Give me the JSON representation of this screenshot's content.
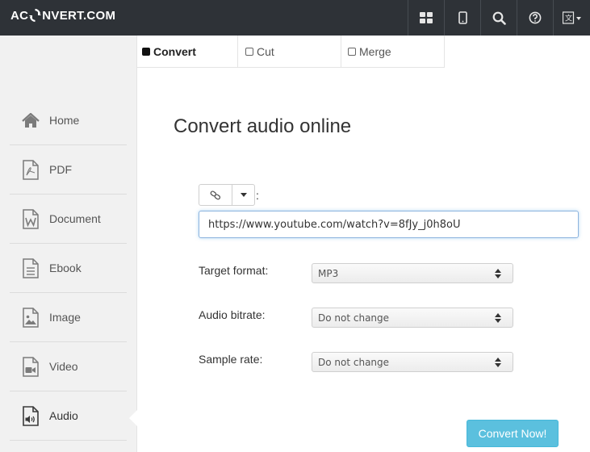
{
  "brand": {
    "left": "AC",
    "right": "NVERT.COM"
  },
  "header": {
    "icons": [
      "apps-grid-icon",
      "mobile-icon",
      "search-icon",
      "help-icon",
      "language-icon"
    ]
  },
  "sidebar": {
    "items": [
      {
        "label": "Home",
        "icon": "home-icon"
      },
      {
        "label": "PDF",
        "icon": "pdf-icon"
      },
      {
        "label": "Document",
        "icon": "document-icon"
      },
      {
        "label": "Ebook",
        "icon": "ebook-icon"
      },
      {
        "label": "Image",
        "icon": "image-icon"
      },
      {
        "label": "Video",
        "icon": "video-icon"
      },
      {
        "label": "Audio",
        "icon": "audio-icon",
        "active": true
      }
    ]
  },
  "tabs": [
    {
      "label": "Convert",
      "active": true
    },
    {
      "label": "Cut"
    },
    {
      "label": "Merge"
    }
  ],
  "main": {
    "title": "Convert audio online",
    "source_colon": ":",
    "url_value": "https://www.youtube.com/watch?v=8fJy_j0h8oU",
    "target_format": {
      "label": "Target format:",
      "value": "MP3"
    },
    "audio_bitrate": {
      "label": "Audio bitrate:",
      "value": "Do not change"
    },
    "sample_rate": {
      "label": "Sample rate:",
      "value": "Do not change"
    },
    "convert_button": "Convert Now!"
  },
  "colors": {
    "topbar": "#2e3237",
    "sidebar": "#f1f1f1",
    "accent": "#5bc0de",
    "icon_gray": "#777777"
  }
}
